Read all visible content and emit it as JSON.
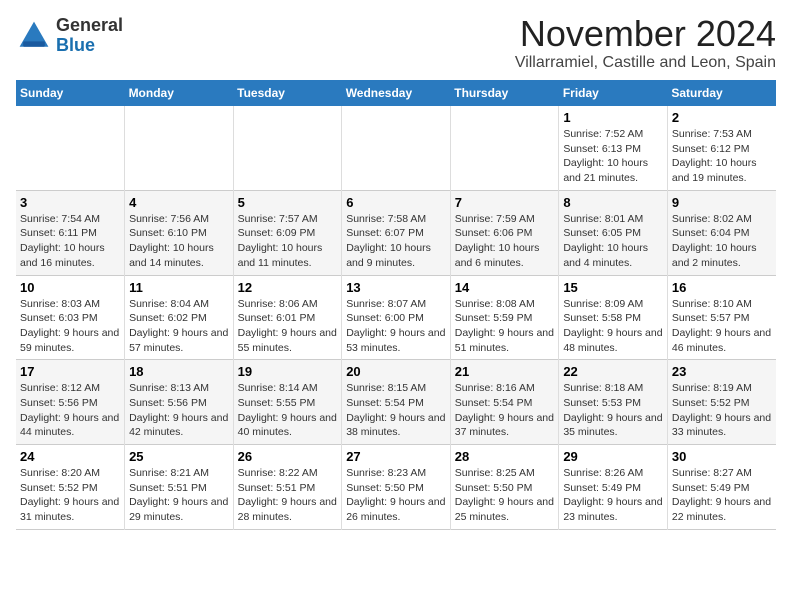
{
  "header": {
    "logo_general": "General",
    "logo_blue": "Blue",
    "month_title": "November 2024",
    "location": "Villarramiel, Castille and Leon, Spain"
  },
  "calendar": {
    "weekdays": [
      "Sunday",
      "Monday",
      "Tuesday",
      "Wednesday",
      "Thursday",
      "Friday",
      "Saturday"
    ],
    "rows": [
      {
        "alt": false,
        "cells": [
          {
            "day": "",
            "info": ""
          },
          {
            "day": "",
            "info": ""
          },
          {
            "day": "",
            "info": ""
          },
          {
            "day": "",
            "info": ""
          },
          {
            "day": "",
            "info": ""
          },
          {
            "day": "1",
            "info": "Sunrise: 7:52 AM\nSunset: 6:13 PM\nDaylight: 10 hours and 21 minutes."
          },
          {
            "day": "2",
            "info": "Sunrise: 7:53 AM\nSunset: 6:12 PM\nDaylight: 10 hours and 19 minutes."
          }
        ]
      },
      {
        "alt": true,
        "cells": [
          {
            "day": "3",
            "info": "Sunrise: 7:54 AM\nSunset: 6:11 PM\nDaylight: 10 hours and 16 minutes."
          },
          {
            "day": "4",
            "info": "Sunrise: 7:56 AM\nSunset: 6:10 PM\nDaylight: 10 hours and 14 minutes."
          },
          {
            "day": "5",
            "info": "Sunrise: 7:57 AM\nSunset: 6:09 PM\nDaylight: 10 hours and 11 minutes."
          },
          {
            "day": "6",
            "info": "Sunrise: 7:58 AM\nSunset: 6:07 PM\nDaylight: 10 hours and 9 minutes."
          },
          {
            "day": "7",
            "info": "Sunrise: 7:59 AM\nSunset: 6:06 PM\nDaylight: 10 hours and 6 minutes."
          },
          {
            "day": "8",
            "info": "Sunrise: 8:01 AM\nSunset: 6:05 PM\nDaylight: 10 hours and 4 minutes."
          },
          {
            "day": "9",
            "info": "Sunrise: 8:02 AM\nSunset: 6:04 PM\nDaylight: 10 hours and 2 minutes."
          }
        ]
      },
      {
        "alt": false,
        "cells": [
          {
            "day": "10",
            "info": "Sunrise: 8:03 AM\nSunset: 6:03 PM\nDaylight: 9 hours and 59 minutes."
          },
          {
            "day": "11",
            "info": "Sunrise: 8:04 AM\nSunset: 6:02 PM\nDaylight: 9 hours and 57 minutes."
          },
          {
            "day": "12",
            "info": "Sunrise: 8:06 AM\nSunset: 6:01 PM\nDaylight: 9 hours and 55 minutes."
          },
          {
            "day": "13",
            "info": "Sunrise: 8:07 AM\nSunset: 6:00 PM\nDaylight: 9 hours and 53 minutes."
          },
          {
            "day": "14",
            "info": "Sunrise: 8:08 AM\nSunset: 5:59 PM\nDaylight: 9 hours and 51 minutes."
          },
          {
            "day": "15",
            "info": "Sunrise: 8:09 AM\nSunset: 5:58 PM\nDaylight: 9 hours and 48 minutes."
          },
          {
            "day": "16",
            "info": "Sunrise: 8:10 AM\nSunset: 5:57 PM\nDaylight: 9 hours and 46 minutes."
          }
        ]
      },
      {
        "alt": true,
        "cells": [
          {
            "day": "17",
            "info": "Sunrise: 8:12 AM\nSunset: 5:56 PM\nDaylight: 9 hours and 44 minutes."
          },
          {
            "day": "18",
            "info": "Sunrise: 8:13 AM\nSunset: 5:56 PM\nDaylight: 9 hours and 42 minutes."
          },
          {
            "day": "19",
            "info": "Sunrise: 8:14 AM\nSunset: 5:55 PM\nDaylight: 9 hours and 40 minutes."
          },
          {
            "day": "20",
            "info": "Sunrise: 8:15 AM\nSunset: 5:54 PM\nDaylight: 9 hours and 38 minutes."
          },
          {
            "day": "21",
            "info": "Sunrise: 8:16 AM\nSunset: 5:54 PM\nDaylight: 9 hours and 37 minutes."
          },
          {
            "day": "22",
            "info": "Sunrise: 8:18 AM\nSunset: 5:53 PM\nDaylight: 9 hours and 35 minutes."
          },
          {
            "day": "23",
            "info": "Sunrise: 8:19 AM\nSunset: 5:52 PM\nDaylight: 9 hours and 33 minutes."
          }
        ]
      },
      {
        "alt": false,
        "cells": [
          {
            "day": "24",
            "info": "Sunrise: 8:20 AM\nSunset: 5:52 PM\nDaylight: 9 hours and 31 minutes."
          },
          {
            "day": "25",
            "info": "Sunrise: 8:21 AM\nSunset: 5:51 PM\nDaylight: 9 hours and 29 minutes."
          },
          {
            "day": "26",
            "info": "Sunrise: 8:22 AM\nSunset: 5:51 PM\nDaylight: 9 hours and 28 minutes."
          },
          {
            "day": "27",
            "info": "Sunrise: 8:23 AM\nSunset: 5:50 PM\nDaylight: 9 hours and 26 minutes."
          },
          {
            "day": "28",
            "info": "Sunrise: 8:25 AM\nSunset: 5:50 PM\nDaylight: 9 hours and 25 minutes."
          },
          {
            "day": "29",
            "info": "Sunrise: 8:26 AM\nSunset: 5:49 PM\nDaylight: 9 hours and 23 minutes."
          },
          {
            "day": "30",
            "info": "Sunrise: 8:27 AM\nSunset: 5:49 PM\nDaylight: 9 hours and 22 minutes."
          }
        ]
      }
    ]
  }
}
